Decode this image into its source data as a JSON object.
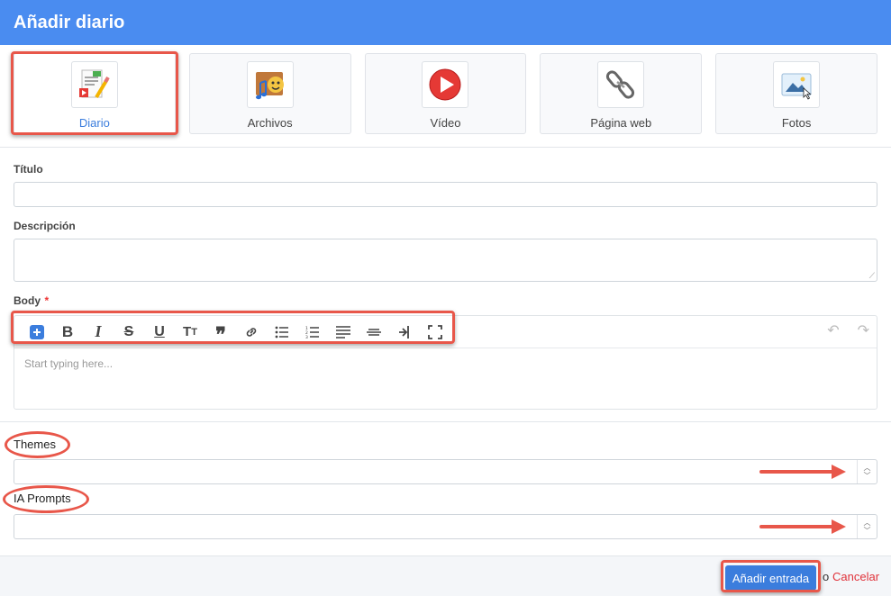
{
  "header": {
    "title": "Añadir diario"
  },
  "tiles": [
    {
      "label": "Diario",
      "icon": "journal-icon",
      "active": true
    },
    {
      "label": "Archivos",
      "icon": "music-theater-icon",
      "active": false
    },
    {
      "label": "Vídeo",
      "icon": "play-icon",
      "active": false
    },
    {
      "label": "Página web",
      "icon": "link-icon",
      "active": false
    },
    {
      "label": "Fotos",
      "icon": "photo-icon",
      "active": false
    }
  ],
  "form": {
    "title_label": "Título",
    "title_value": "",
    "description_label": "Descripción",
    "description_value": "",
    "body_label": "Body",
    "body_required_mark": "*",
    "body_placeholder": "Start typing here...",
    "toolbar": [
      "add-block",
      "bold",
      "italic",
      "strikethrough",
      "underline",
      "text-size",
      "quote",
      "link",
      "bullet-list",
      "numbered-list",
      "align",
      "horizontal-rule",
      "indent",
      "fullscreen",
      "undo",
      "redo"
    ],
    "themes_label": "Themes",
    "themes_value": "",
    "prompts_label": "IA Prompts",
    "prompts_value": ""
  },
  "footer": {
    "submit_label": "Añadir entrada",
    "or_text": "o",
    "cancel_label": "Cancelar"
  },
  "colors": {
    "header": "#4a8cf0",
    "primary": "#3b7ddd",
    "annotation": "#e8574a",
    "cancel": "#e0323a"
  }
}
